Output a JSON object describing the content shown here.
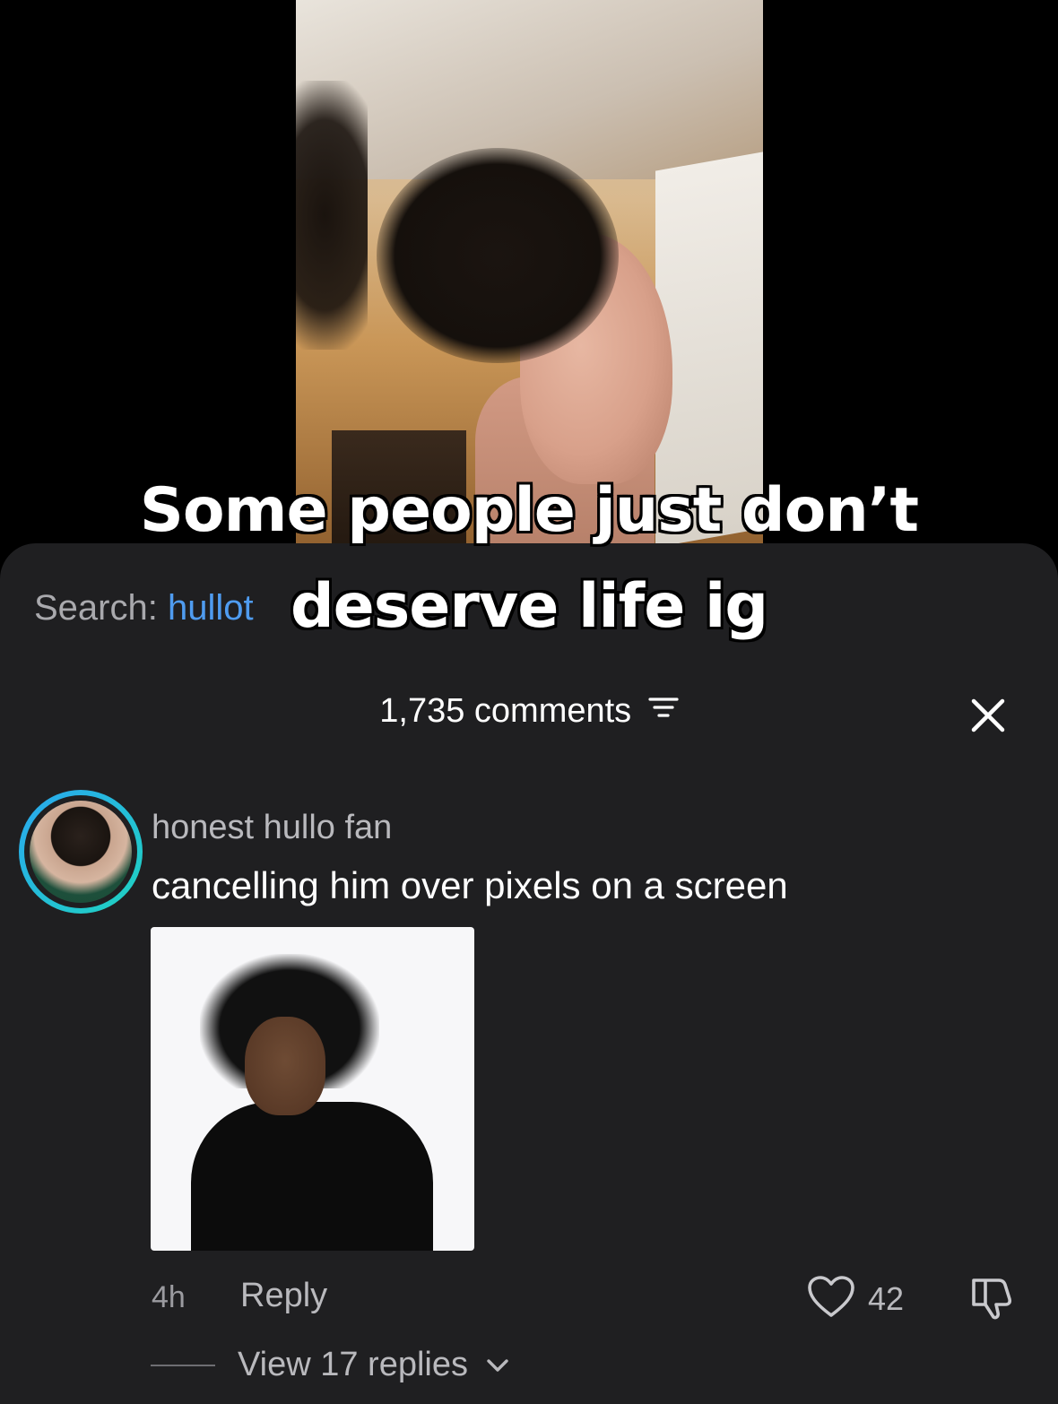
{
  "video": {
    "caption_line_1": "Some people just don’t",
    "caption_line_2": "deserve life ig"
  },
  "search": {
    "label": "Search:",
    "query": "hullot"
  },
  "comments": {
    "count_label": "1,735 comments",
    "filter_icon": "filter-icon",
    "close_icon": "close-icon"
  },
  "comment": {
    "username": "honest hullo fan",
    "text": "cancelling him over pixels on a screen",
    "time": "4h",
    "reply_label": "Reply",
    "like_count": "42",
    "view_replies_label": "View 17 replies"
  },
  "colors": {
    "background": "#000000",
    "sheet": "#1f1f21",
    "link_blue": "#4f9cf0",
    "ring_gradient_start": "#2aa7f0",
    "ring_gradient_end": "#1fd3c0"
  }
}
